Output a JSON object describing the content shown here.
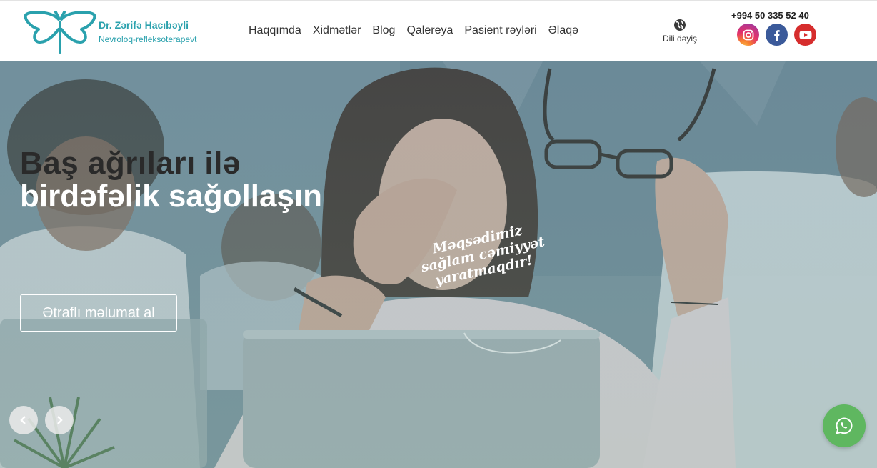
{
  "brand": {
    "name": "Dr. Zərifə Hacıbəyli",
    "subtitle": "Nevroloq-refleksoterapevt",
    "color": "#2aa1ad"
  },
  "nav": {
    "items": [
      {
        "label": "Haqqımda"
      },
      {
        "label": "Xidmətlər"
      },
      {
        "label": "Blog"
      },
      {
        "label": "Qalereya"
      },
      {
        "label": "Pasient rəyləri"
      },
      {
        "label": "Əlaqə"
      }
    ]
  },
  "language": {
    "label": "Dili dəyiş",
    "icon": "globe-icon"
  },
  "contact": {
    "phone": "+994 50 335 52 40"
  },
  "social": [
    {
      "name": "instagram",
      "icon": "instagram-icon",
      "color": "#e1306c"
    },
    {
      "name": "facebook",
      "icon": "facebook-icon",
      "color": "#3b5a9a"
    },
    {
      "name": "youtube",
      "icon": "youtube-icon",
      "color": "#d62d2d"
    }
  ],
  "hero": {
    "headline_line1": "Baş ağrıları ilə",
    "headline_line2": "birdəfəlik sağollaşın",
    "button_label": "Ətraflı məlumat al",
    "slogan": [
      "Məqsədimiz",
      "sağlam cəmiyyət",
      "yaratmaqdır!"
    ]
  },
  "carousel": {
    "prev_icon": "chevron-left-icon",
    "next_icon": "chevron-right-icon"
  },
  "whatsapp": {
    "icon": "whatsapp-icon",
    "color": "#5fb760"
  }
}
